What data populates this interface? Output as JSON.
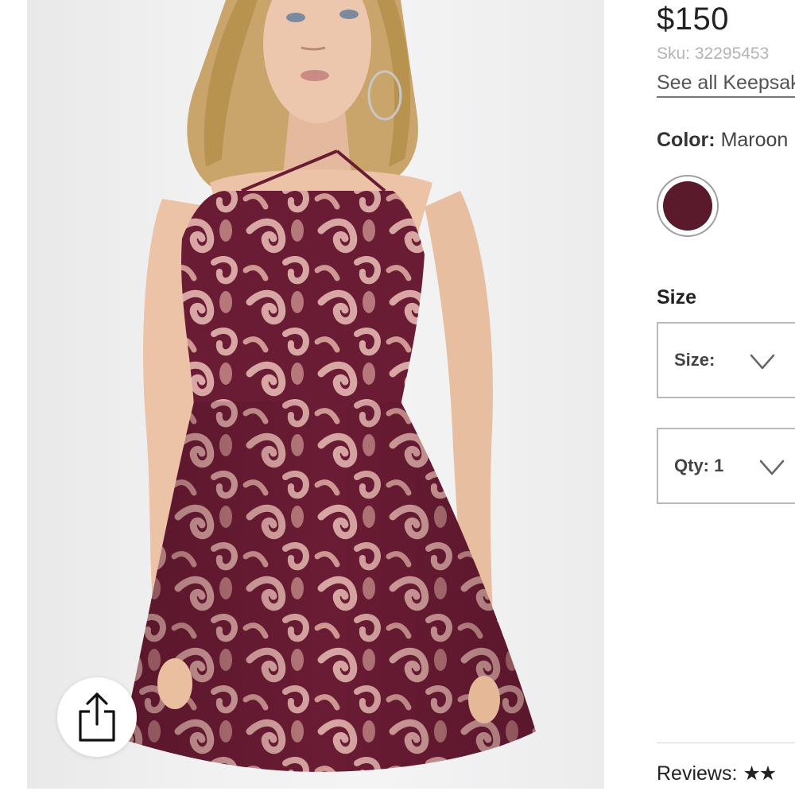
{
  "product": {
    "price": "$150",
    "sku": "Sku: 32295453",
    "see_all_link": "See all Keepsake",
    "color_label": "Color:",
    "color_value": "Maroon",
    "swatch_color": "#5a1a2c",
    "size_heading": "Size",
    "size_select_label": "Size:",
    "qty_select_label": "Qty: 1",
    "reviews_label": "Reviews:",
    "reviews_stars": "★★"
  },
  "image": {
    "dress_color": "#6a1c34",
    "lining_color": "#d9a7a3",
    "skin_color": "#e9c3a7",
    "hair_color": "#c9a56c",
    "background_color": "#efefef"
  },
  "icons": {
    "share": "share-icon",
    "dropdown": "chevron-down-icon"
  }
}
